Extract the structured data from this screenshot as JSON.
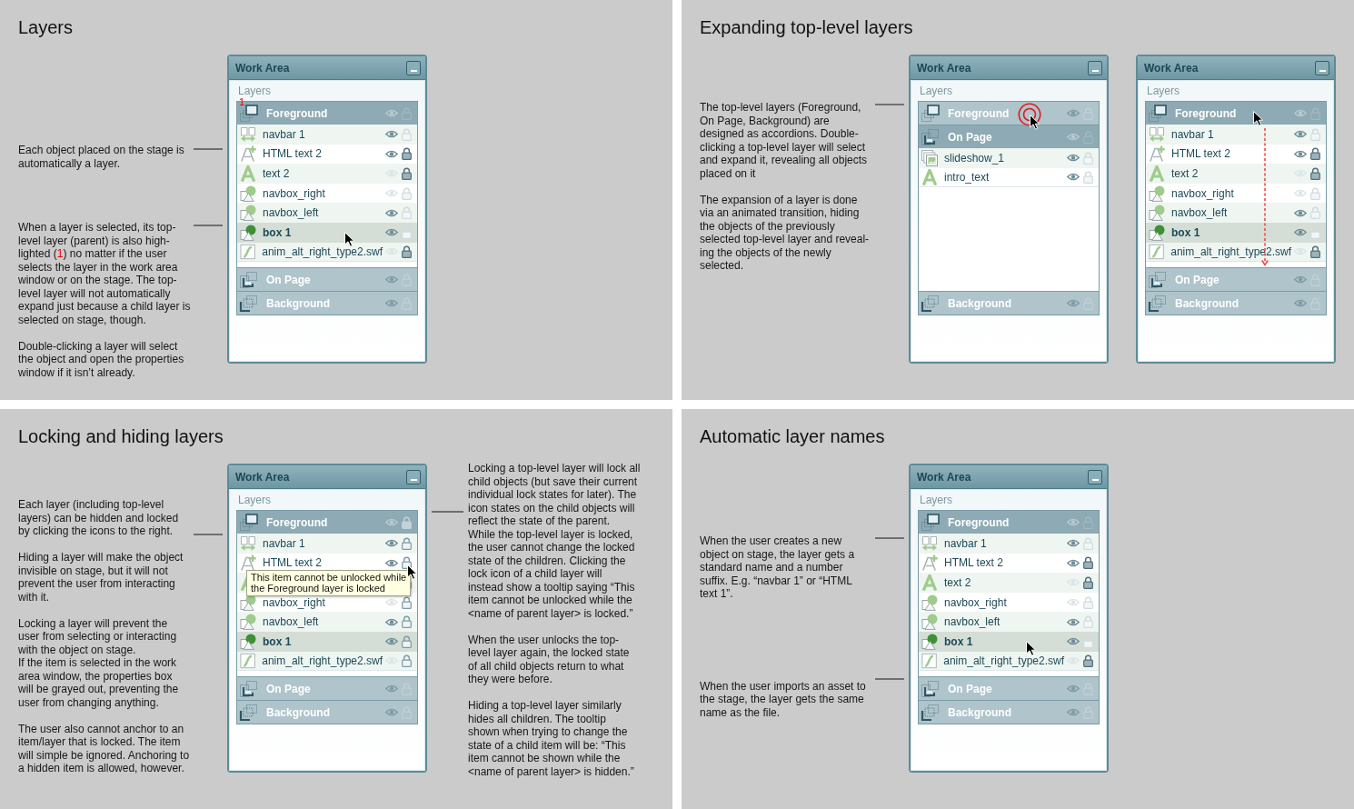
{
  "sections": [
    {
      "title": "Layers",
      "notes": [
        {
          "paragraphs": [
            {
              "text": "Each object placed on the stage is\nautomatically a layer."
            }
          ]
        },
        {
          "paragraphs": [
            {
              "runs": [
                {
                  "text": "When a layer is selected, its top-\nlevel layer (parent) is also high-\nlighted (",
                  "kind": "plain"
                },
                {
                  "text": "1",
                  "kind": "callout"
                },
                {
                  "text": ") no matter if the user\nselects the layer in the work area\nwindow or on the stage. The top-\nlevel layer will not automatically\nexpand just because a child layer is\nselected on stage, though.",
                  "kind": "plain"
                }
              ]
            },
            {
              "text": "Double-clicking a layer will select\nthe object and open the properties\nwindow if it isn’t already."
            }
          ]
        }
      ],
      "panels": [
        {
          "title": "Work Area",
          "label": "Layers",
          "layers": [
            {
              "name": "Foreground",
              "kind": "foreground",
              "selected": true,
              "expanded": true,
              "visible": true,
              "locked": false,
              "callout": "1",
              "children": [
                {
                  "name": "navbar 1",
                  "kind": "navbar",
                  "selected": false,
                  "visible": true,
                  "locked": false
                },
                {
                  "name": "HTML text 2",
                  "kind": "html_text",
                  "selected": false,
                  "visible": true,
                  "locked": true
                },
                {
                  "name": "text 2",
                  "kind": "text",
                  "selected": false,
                  "visible": false,
                  "locked": true
                },
                {
                  "name": "navbox_right",
                  "kind": "shape",
                  "selected": false,
                  "visible": false,
                  "locked": false
                },
                {
                  "name": "navbox_left",
                  "kind": "shape",
                  "selected": false,
                  "visible": true,
                  "locked": false
                },
                {
                  "name": "box 1",
                  "kind": "shape",
                  "selected": true,
                  "visible": true,
                  "locked": false,
                  "hovered": true
                },
                {
                  "name": "anim_alt_right_type2.swf",
                  "kind": "swf",
                  "selected": false,
                  "visible": false,
                  "locked": true
                }
              ]
            },
            {
              "name": "On Page",
              "kind": "on_page",
              "selected": false,
              "expanded": false,
              "visible": true,
              "locked": false
            },
            {
              "name": "Background",
              "kind": "background",
              "selected": false,
              "expanded": false,
              "visible": true,
              "locked": false
            }
          ]
        }
      ]
    },
    {
      "title": "Expanding top-level layers",
      "notes": [
        {
          "paragraphs": [
            {
              "text": "The top-level layers (Foreground,\nOn Page, Background) are\ndesigned as accordions. Double-\nclicking a top-level layer will select\nand expand it, revealing all objects\nplaced on it"
            },
            {
              "text": "The expansion of a layer is done\nvia an animated transition, hiding\nthe objects of the previously\nselected top-level layer and reveal-\ning the objects of the newly\nselected."
            }
          ]
        }
      ],
      "panels": [
        {
          "title": "Work Area",
          "label": "Layers",
          "layers": [
            {
              "name": "Foreground",
              "kind": "foreground",
              "selected": false,
              "expanded": false,
              "visible": true,
              "locked": false,
              "hovered": true,
              "clicked": true
            },
            {
              "name": "On Page",
              "kind": "on_page",
              "selected": true,
              "expanded": true,
              "visible": true,
              "locked": false,
              "children": [
                {
                  "name": "slideshow_1",
                  "kind": "slideshow",
                  "selected": false,
                  "visible": true,
                  "locked": false
                },
                {
                  "name": "intro_text",
                  "kind": "text",
                  "selected": false,
                  "visible": true,
                  "locked": false
                }
              ]
            },
            {
              "name": "Background",
              "kind": "background",
              "selected": false,
              "expanded": false,
              "visible": true,
              "locked": false
            }
          ]
        },
        {
          "title": "Work Area",
          "label": "Layers",
          "layers": [
            {
              "name": "Foreground",
              "kind": "foreground",
              "selected": true,
              "expanded": true,
              "visible": true,
              "locked": false,
              "hovered": true,
              "expansion_arrow": true,
              "children": [
                {
                  "name": "navbar 1",
                  "kind": "navbar",
                  "selected": false,
                  "visible": true,
                  "locked": false
                },
                {
                  "name": "HTML text 2",
                  "kind": "html_text",
                  "selected": false,
                  "visible": true,
                  "locked": true
                },
                {
                  "name": "text 2",
                  "kind": "text",
                  "selected": false,
                  "visible": false,
                  "locked": true
                },
                {
                  "name": "navbox_right",
                  "kind": "shape",
                  "selected": false,
                  "visible": false,
                  "locked": false
                },
                {
                  "name": "navbox_left",
                  "kind": "shape",
                  "selected": false,
                  "visible": true,
                  "locked": false
                },
                {
                  "name": "box 1",
                  "kind": "shape",
                  "selected": true,
                  "visible": true,
                  "locked": false
                },
                {
                  "name": "anim_alt_right_type2.swf",
                  "kind": "swf",
                  "selected": false,
                  "visible": false,
                  "locked": true
                }
              ]
            },
            {
              "name": "On Page",
              "kind": "on_page",
              "selected": false,
              "expanded": false,
              "visible": true,
              "locked": false
            },
            {
              "name": "Background",
              "kind": "background",
              "selected": false,
              "expanded": false,
              "visible": true,
              "locked": false
            }
          ]
        }
      ]
    },
    {
      "title": "Locking and hiding layers",
      "notes": [
        {
          "paragraphs": [
            {
              "text": "Each layer (including top-level\nlayers) can be hidden and locked\nby clicking the icons to the right."
            },
            {
              "text": "Hiding a layer will make the object\ninvisible on stage, but it will not\nprevent the user from interacting\nwith it."
            },
            {
              "text": "Locking a layer will prevent the\nuser from selecting or interacting\nwith the object on stage.\nIf the item is selected in the work\narea window, the properties box\nwill be grayed out, preventing the\nuser from changing anything."
            },
            {
              "text": "The user also cannot anchor to an\nitem/layer that is locked. The item\nwill simple be ignored. Anchoring to\na hidden item is allowed, however."
            }
          ]
        }
      ],
      "panels": [
        {
          "title": "Work Area",
          "label": "Layers",
          "layers": [
            {
              "name": "Foreground",
              "kind": "foreground",
              "selected": true,
              "expanded": true,
              "visible": true,
              "locked": true,
              "children": [
                {
                  "name": "navbar 1",
                  "kind": "navbar",
                  "selected": false,
                  "visible": true
                },
                {
                  "name": "HTML text 2",
                  "kind": "html_text",
                  "selected": false,
                  "visible": true,
                  "hovered": true,
                  "tooltip": "This item cannot be unlocked while\nthe Foreground layer is locked"
                },
                {
                  "kind": "text",
                  "selected": false
                },
                {
                  "name": "navbox_right",
                  "kind": "shape",
                  "selected": false,
                  "visible": false
                },
                {
                  "name": "navbox_left",
                  "kind": "shape",
                  "selected": false,
                  "visible": true
                },
                {
                  "name": "box 1",
                  "kind": "shape",
                  "selected": true,
                  "visible": true
                },
                {
                  "name": "anim_alt_right_type2.swf",
                  "kind": "swf",
                  "selected": false,
                  "visible": false
                }
              ]
            },
            {
              "name": "On Page",
              "kind": "on_page",
              "selected": false,
              "expanded": false,
              "visible": true,
              "locked": false
            },
            {
              "name": "Background",
              "kind": "background",
              "selected": false,
              "expanded": false,
              "visible": true,
              "locked": false
            }
          ]
        }
      ],
      "right_notes": [
        {
          "paragraphs": [
            {
              "text": "Locking a top-level layer will lock all\nchild objects (but save their current\nindividual lock states for later). The\nicon states on the child objects will\nreflect the state of the parent.\nWhile the top-level layer is locked,\nthe user cannot change the locked\nstate of the children. Clicking the\nlock icon of a child layer will\ninstead show a tooltip saying “This\nitem cannot be unlocked while the\n<name of parent layer> is locked.”"
            },
            {
              "text": "When the user unlocks the top-\nlevel layer again, the locked state\nof all child objects return to what\nthey were before."
            },
            {
              "text": "Hiding a top-level layer similarly\nhides all children. The tooltip\nshown when trying to change the\nstate of a child item will be: “This\nitem cannot be shown while the\n<name of parent layer> is hidden.”"
            }
          ]
        }
      ]
    },
    {
      "title": "Automatic layer names",
      "notes": [
        {
          "paragraphs": [
            {
              "text": "When the user creates a new\nobject on stage, the layer gets a\nstandard name and a number\nsuffix. E.g. “navbar 1” or “HTML\ntext 1”."
            }
          ]
        },
        {
          "paragraphs": [
            {
              "text": "When the user imports an asset to\nthe stage, the layer gets the same\nname as the file."
            }
          ]
        }
      ],
      "panels": [
        {
          "title": "Work Area",
          "label": "Layers",
          "layers": [
            {
              "name": "Foreground",
              "kind": "foreground",
              "selected": true,
              "expanded": true,
              "visible": true,
              "locked": false,
              "children": [
                {
                  "name": "navbar 1",
                  "kind": "navbar",
                  "selected": false,
                  "visible": true,
                  "locked": false
                },
                {
                  "name": "HTML text 2",
                  "kind": "html_text",
                  "selected": false,
                  "visible": true,
                  "locked": true
                },
                {
                  "name": "text 2",
                  "kind": "text",
                  "selected": false,
                  "visible": false,
                  "locked": true
                },
                {
                  "name": "navbox_right",
                  "kind": "shape",
                  "selected": false,
                  "visible": false,
                  "locked": false
                },
                {
                  "name": "navbox_left",
                  "kind": "shape",
                  "selected": false,
                  "visible": true,
                  "locked": false
                },
                {
                  "name": "box 1",
                  "kind": "shape",
                  "selected": true,
                  "visible": true,
                  "locked": false,
                  "hovered": true
                },
                {
                  "name": "anim_alt_right_type2.swf",
                  "kind": "swf",
                  "selected": false,
                  "visible": false,
                  "locked": true
                }
              ]
            },
            {
              "name": "On Page",
              "kind": "on_page",
              "selected": false,
              "expanded": false,
              "visible": true,
              "locked": false
            },
            {
              "name": "Background",
              "kind": "background",
              "selected": false,
              "expanded": false,
              "visible": true,
              "locked": false
            }
          ]
        }
      ]
    }
  ]
}
